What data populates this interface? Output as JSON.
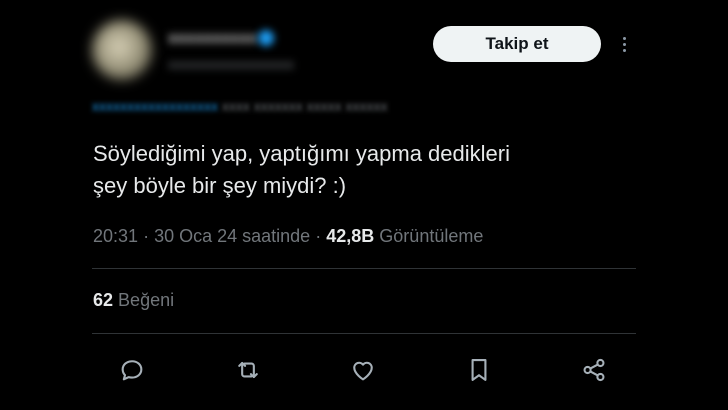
{
  "header": {
    "follow_label": "Takip et"
  },
  "tweet": {
    "line1": "Söylediğimi yap, yaptığımı yapma dedikleri",
    "line2": "şey böyle bir şey miydi? :)"
  },
  "meta": {
    "time": "20:31",
    "separator": "·",
    "date": "30 Oca 24 saatinde",
    "views_count": "42,8B",
    "views_label": "Görüntüleme"
  },
  "stats": {
    "likes_count": "62",
    "likes_label": "Beğeni"
  },
  "actions": [
    "reply-icon",
    "retweet-icon",
    "like-icon",
    "bookmark-icon",
    "share-icon"
  ],
  "colors": {
    "background": "#000000",
    "text_primary": "#e7e9ea",
    "text_secondary": "#71767b",
    "divider": "#2f3336",
    "button_bg": "#eff3f4",
    "button_text": "#0f1419",
    "accent": "#1d9bf0"
  }
}
